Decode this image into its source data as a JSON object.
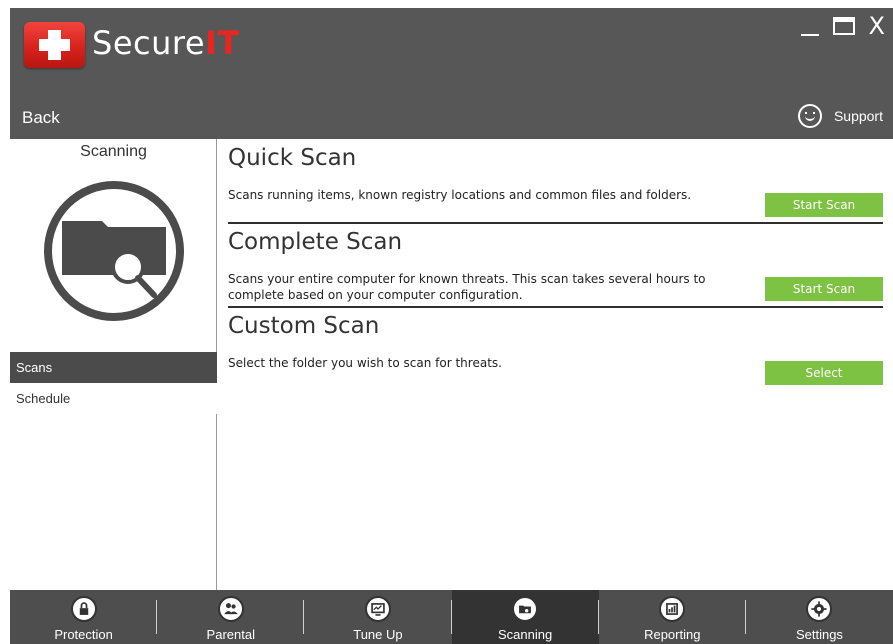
{
  "app": {
    "brand_main": "Secure",
    "brand_accent": "IT",
    "close_glyph": "X"
  },
  "header": {
    "back_label": "Back",
    "support_label": "Support"
  },
  "sidebar": {
    "title": "Scanning",
    "items": [
      {
        "label": "Scans",
        "active": true
      },
      {
        "label": "Schedule",
        "active": false
      }
    ]
  },
  "main": {
    "sections": [
      {
        "title": "Quick Scan",
        "description": "Scans running items, known registry locations and common files and folders.",
        "button_label": "Start Scan"
      },
      {
        "title": "Complete Scan",
        "description": "Scans your entire computer for known threats. This scan takes several hours to complete based on your computer configuration.",
        "button_label": "Start Scan"
      },
      {
        "title": "Custom Scan",
        "description": "Select the folder you wish to scan for threats.",
        "button_label": "Select"
      }
    ]
  },
  "bottom_nav": {
    "tabs": [
      {
        "label": "Protection",
        "icon": "lock-icon",
        "active": false
      },
      {
        "label": "Parental",
        "icon": "people-icon",
        "active": false
      },
      {
        "label": "Tune Up",
        "icon": "monitor-icon",
        "active": false
      },
      {
        "label": "Scanning",
        "icon": "scan-folder-icon",
        "active": true
      },
      {
        "label": "Reporting",
        "icon": "chart-icon",
        "active": false
      },
      {
        "label": "Settings",
        "icon": "gear-icon",
        "active": false
      }
    ]
  },
  "colors": {
    "titlebar": "#575757",
    "accent_red": "#e8261f",
    "button_green": "#7dc242",
    "active_nav": "#4b4b4b",
    "bottom_nav": "#4e4e4e"
  }
}
